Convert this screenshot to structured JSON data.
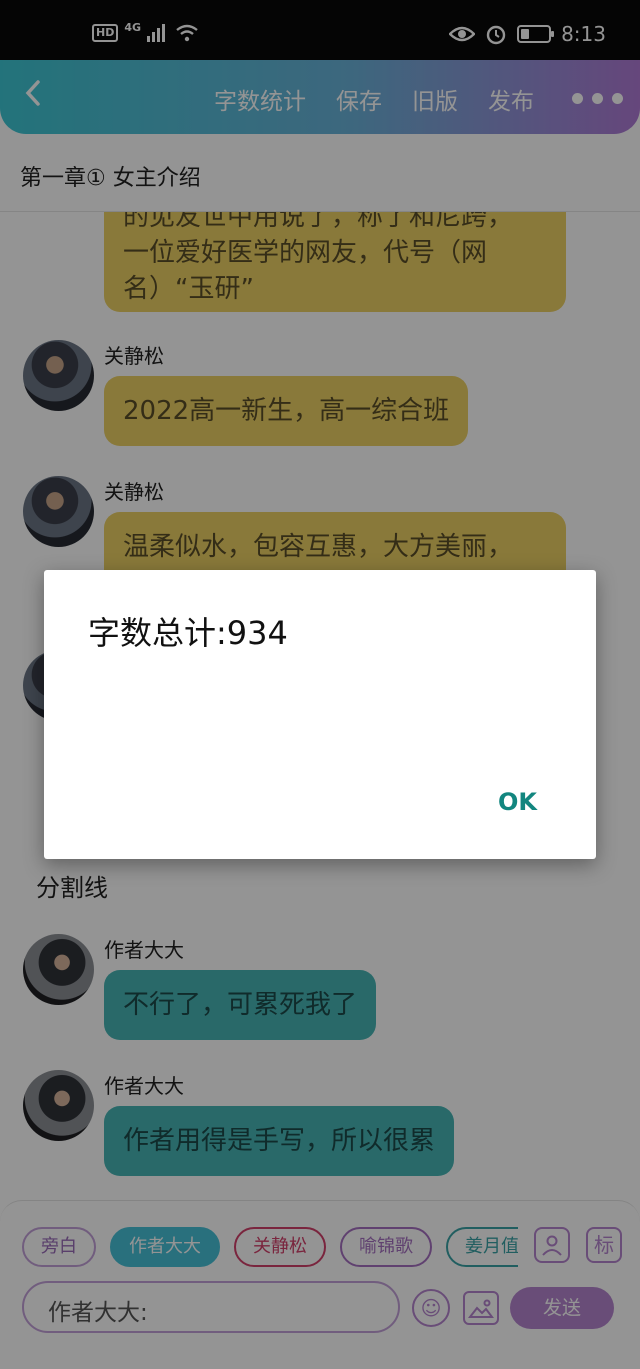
{
  "status_bar": {
    "hd": "HD",
    "signal": "4G",
    "time": "8:13"
  },
  "nav": {
    "back_icon": "chevron-left-icon",
    "actions": [
      "字数统计",
      "保存",
      "旧版",
      "发布"
    ],
    "more_icon": "more-dots-icon"
  },
  "chapter_title": "第一章① 女主介绍",
  "messages": [
    {
      "text": "的见友世中用说了，称了和尼跨，\n一位爱好医学的网友，代号（网\n名）“玉研”"
    },
    {
      "name": "关静松",
      "text": "2022高一新生，高一综合班"
    },
    {
      "name": "关静松",
      "text": "温柔似水，包容互惠，大方美丽，"
    },
    {
      "divider": "分割线"
    },
    {
      "name": "作者大大",
      "text": "不行了，可累死我了"
    },
    {
      "name": "作者大大",
      "text": "作者用得是手写，所以很累"
    }
  ],
  "colors": {
    "yellow_bubble": "#ecd065",
    "teal_bubble": "#48b6b6",
    "accent_purple": "#b685cf",
    "ok_color": "#12867f"
  },
  "bottom": {
    "roles": [
      "旁白",
      "作者大大",
      "关静松",
      "喻锦歌",
      "姜月值"
    ],
    "active_role": "作者大大",
    "role_icon_label": "person-icon",
    "tag_button": "标",
    "input_placeholder": "作者大大:",
    "send": "发送"
  },
  "dialog": {
    "message": "字数总计:934",
    "ok": "OK"
  }
}
